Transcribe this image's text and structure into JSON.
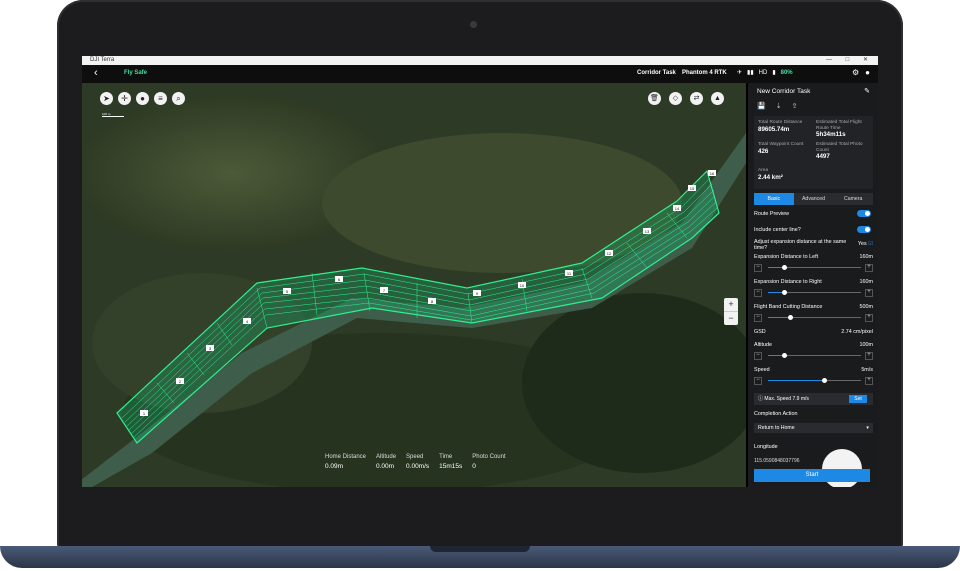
{
  "window": {
    "title": "DJI Terra",
    "controls": "— □ ✕"
  },
  "topbar": {
    "back_icon": "‹",
    "fly_safe": "Fly Safe",
    "task": "Corridor Task",
    "drone": "Phantom 4 RTK",
    "hd": "HD",
    "battery": "80%"
  },
  "map": {
    "scale": "100 m",
    "segment_labels": [
      "1",
      "2",
      "3",
      "4",
      "5",
      "6",
      "7",
      "8",
      "9",
      "10",
      "11",
      "12",
      "13",
      "14",
      "15",
      "16"
    ],
    "zoom_in": "+",
    "zoom_out": "−"
  },
  "stats": [
    {
      "label": "Home Distance",
      "value": "0.09m"
    },
    {
      "label": "Altitude",
      "value": "0.00m"
    },
    {
      "label": "Speed",
      "value": "0.00m/s"
    },
    {
      "label": "Time",
      "value": "15m15s"
    },
    {
      "label": "Photo Count",
      "value": "0"
    }
  ],
  "panel": {
    "title": "New Corridor Task",
    "summary": {
      "route_distance_label": "Total Route Distance",
      "route_distance": "89605.74m",
      "flight_time_label": "Estimated Total Flight Route Time",
      "flight_time": "5h34m11s",
      "waypoint_label": "Total Waypoint Count",
      "waypoint": "426",
      "photo_label": "Estimated Total Photo Count",
      "photo": "4497",
      "area_label": "Area",
      "area": "2.44 km²"
    },
    "tabs": [
      "Basic",
      "Advanced",
      "Camera"
    ],
    "route_preview": "Route Preview",
    "center_line": "Include center line?",
    "adjust_label": "Adjust expansion distance at the same time?",
    "adjust_value": "Yes",
    "left_label": "Expansion Distance to Left",
    "left_value": "160m",
    "left_level": 0.17,
    "right_label": "Expansion Distance to Right",
    "right_value": "160m",
    "right_level": 0.17,
    "cut_label": "Flight Band Cutting Distance",
    "cut_value": "500m",
    "cut_level": 0.24,
    "gsd_label": "GSD",
    "gsd_value": "2.74 cm/pixel",
    "altitude_label": "Altitude",
    "altitude_value": "100m",
    "altitude_level": 0.17,
    "speed_label": "Speed",
    "speed_value": "5m/s",
    "speed_level": 0.6,
    "max_speed": "Max. Speed 7.9 m/s",
    "set": "Set",
    "completion_label": "Completion Action",
    "completion_value": "Return to Home",
    "longitude_label": "Longitude",
    "longitude_value": "115.0590848037796",
    "start": "Start"
  }
}
